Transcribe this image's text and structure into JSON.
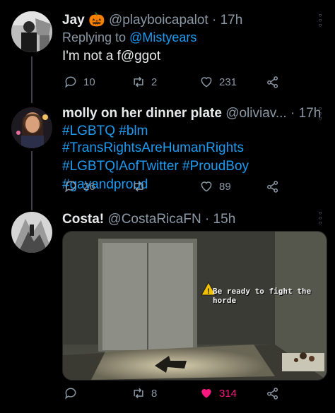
{
  "tweets": [
    {
      "name": "Jay",
      "name_emoji": "🎃",
      "handle": "@playboicapalot",
      "time": "· 17h",
      "replying_prefix": "Replying to",
      "replying_to": "@Mistyears",
      "text": "I'm not a f@ggot",
      "replies": "10",
      "retweets": "2",
      "likes": "231"
    },
    {
      "name": "molly on her dinner plate",
      "handle": "@oliviav...",
      "time": "· 17h",
      "hashtags_line1": "#LGBTQ #blm #TransRightsAreHumanRights",
      "hashtags_line2": "#LGBTQIAofTwitter #ProudBoy",
      "hashtags_line3": "#gayandproud",
      "replies": "26",
      "retweets": "",
      "likes": "89"
    },
    {
      "name": "Costa!",
      "handle": "@CostaRicaFN",
      "time": "· 15h",
      "media_caption": "Be ready to fight the horde",
      "replies": "",
      "retweets": "8",
      "likes": "314",
      "liked": true
    }
  ],
  "icons": {
    "reply": "reply-icon",
    "retweet": "retweet-icon",
    "like": "heart-icon",
    "share": "share-icon",
    "more": "more-icon",
    "warning": "warning-icon"
  },
  "colors": {
    "background": "#000000",
    "link": "#1d9bf0",
    "muted": "#8b98a5",
    "like": "#f91880"
  }
}
